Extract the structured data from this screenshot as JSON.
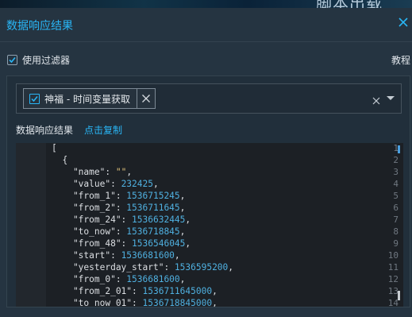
{
  "dialog": {
    "title": "数据响应结果",
    "use_filter_label": "使用过滤器",
    "use_filter_checked": true,
    "tutorial_link": "教程",
    "background_text": "脚本出载"
  },
  "filter_select": {
    "selected_tag": "神福 - 时间变量获取",
    "tag_checked": true
  },
  "response": {
    "label": "数据响应结果",
    "copy_link": "点击复制"
  },
  "editor": {
    "lines": [
      {
        "n": "1",
        "text": "["
      },
      {
        "n": "2",
        "text": "  {"
      },
      {
        "n": "3",
        "key": "\"name\"",
        "val": "\"\"",
        "kind": "str"
      },
      {
        "n": "4",
        "key": "\"value\"",
        "val": "232425",
        "kind": "num"
      },
      {
        "n": "5",
        "key": "\"from_1\"",
        "val": "1536715245",
        "kind": "num"
      },
      {
        "n": "6",
        "key": "\"from_2\"",
        "val": "1536711645",
        "kind": "num"
      },
      {
        "n": "7",
        "key": "\"from_24\"",
        "val": "1536632445",
        "kind": "num"
      },
      {
        "n": "8",
        "key": "\"to_now\"",
        "val": "1536718845",
        "kind": "num"
      },
      {
        "n": "9",
        "key": "\"from_48\"",
        "val": "1536546045",
        "kind": "num"
      },
      {
        "n": "10",
        "key": "\"start\"",
        "val": "1536681600",
        "kind": "num"
      },
      {
        "n": "11",
        "key": "\"yesterday_start\"",
        "val": "1536595200",
        "kind": "num"
      },
      {
        "n": "12",
        "key": "\"from_0\"",
        "val": "1536681600",
        "kind": "num"
      },
      {
        "n": "13",
        "key": "\"from_2_01\"",
        "val": "1536711645000",
        "kind": "num"
      },
      {
        "n": "14",
        "key": "\"to_now_01\"",
        "val": "1536718845000",
        "kind": "num"
      }
    ]
  },
  "colors": {
    "accent": "#29b6f6",
    "panel_bg": "#253441",
    "editor_bg": "#1c2025",
    "number": "#4fb0e0"
  }
}
